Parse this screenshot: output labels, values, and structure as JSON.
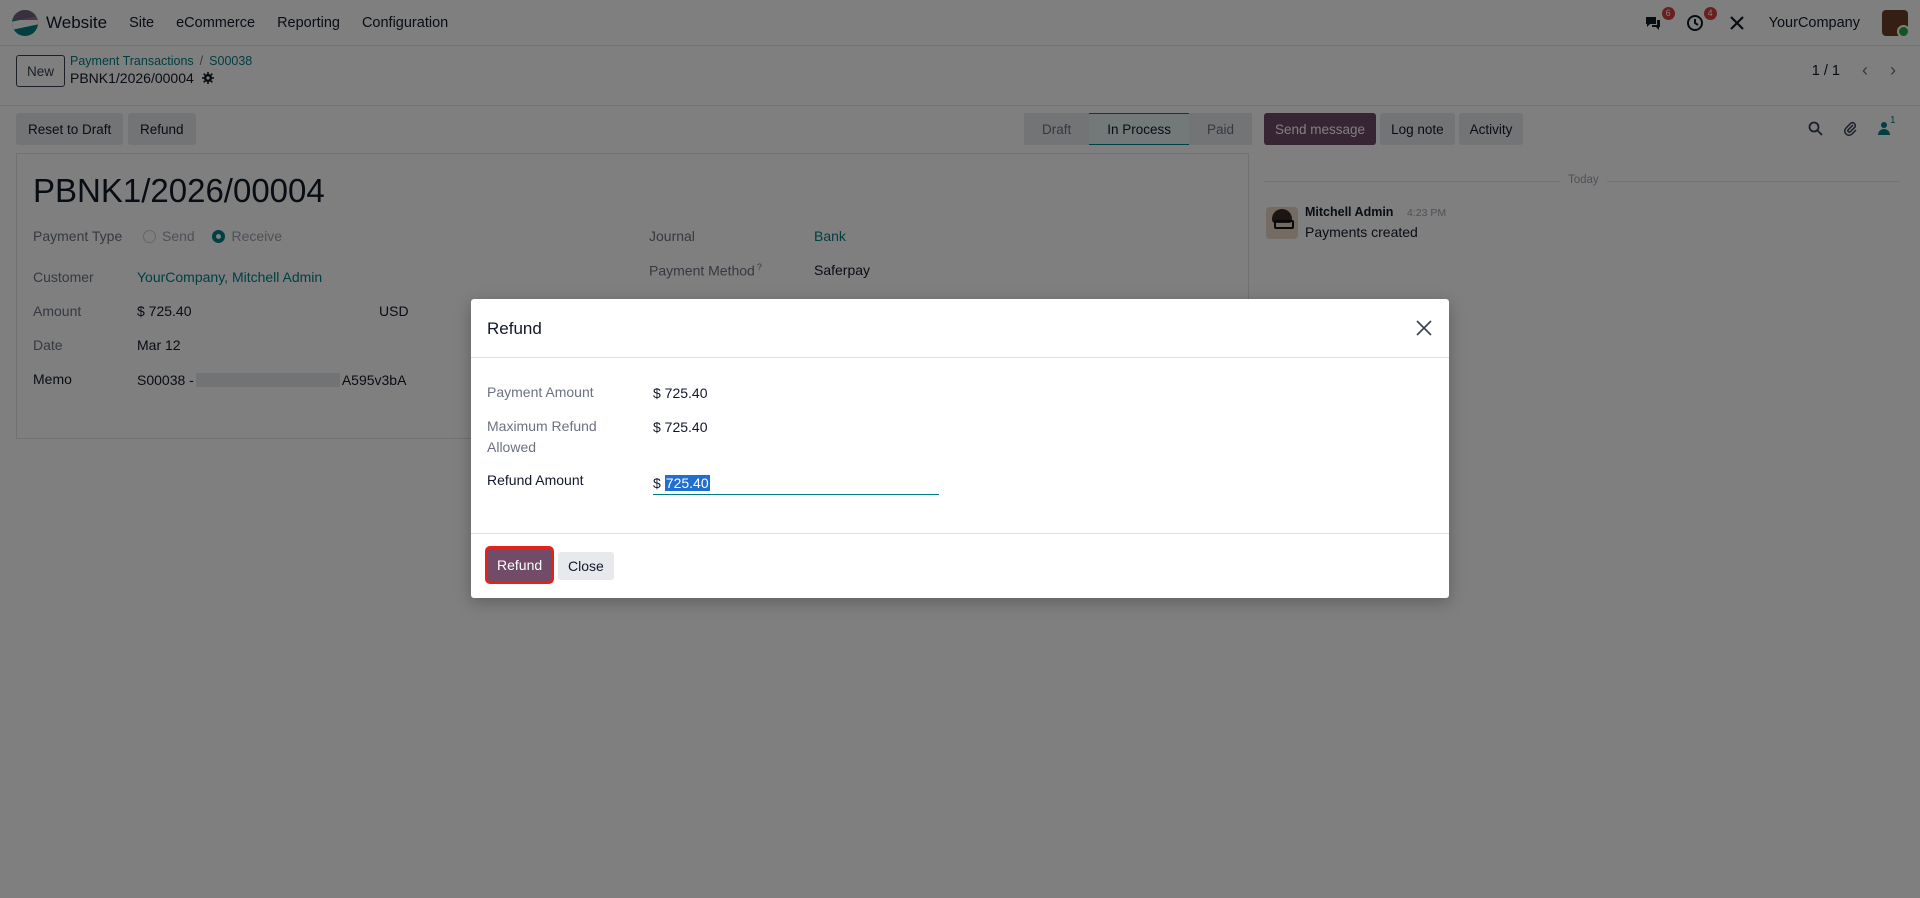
{
  "navbar": {
    "app_name": "Website",
    "menus": [
      "Site",
      "eCommerce",
      "Reporting",
      "Configuration"
    ],
    "messages_badge": "6",
    "activities_badge": "4",
    "company": "YourCompany"
  },
  "control": {
    "new_label": "New",
    "breadcrumb": [
      "Payment Transactions",
      "S00038"
    ],
    "record_name": "PBNK1/2026/00004",
    "pager": "1 / 1"
  },
  "actions": {
    "reset_label": "Reset to Draft",
    "refund_label": "Refund",
    "statuses": [
      "Draft",
      "In Process",
      "Paid"
    ],
    "active_status": "In Process"
  },
  "form": {
    "title": "PBNK1/2026/00004",
    "payment_type_label": "Payment Type",
    "payment_type_send": "Send",
    "payment_type_receive": "Receive",
    "customer_label": "Customer",
    "customer_value": "YourCompany, Mitchell Admin",
    "amount_label": "Amount",
    "amount_value": "$ 725.40",
    "currency": "USD",
    "date_label": "Date",
    "date_value": "Mar 12",
    "memo_label": "Memo",
    "memo_prefix": "S00038 -",
    "memo_suffix": "A595v3bA",
    "journal_label": "Journal",
    "journal_value": "Bank",
    "method_label": "Payment Method",
    "method_hint": "?",
    "method_value": "Saferpay"
  },
  "chatter": {
    "send_message": "Send message",
    "log_note": "Log note",
    "activity": "Activity",
    "followers_count": "1",
    "separator": "Today",
    "author": "Mitchell Admin",
    "time": "4:23 PM",
    "body": "Payments created"
  },
  "modal": {
    "title": "Refund",
    "payment_amount_label": "Payment Amount",
    "payment_amount_value": "$ 725.40",
    "max_refund_label": "Maximum Refund Allowed",
    "max_refund_value": "$ 725.40",
    "refund_amount_label": "Refund Amount",
    "refund_currency": "$",
    "refund_amount_value": "725.40",
    "refund_button": "Refund",
    "close_button": "Close"
  },
  "colors": {
    "brand": "#714b67",
    "accent": "#017e84",
    "highlight": "#e4211a"
  }
}
